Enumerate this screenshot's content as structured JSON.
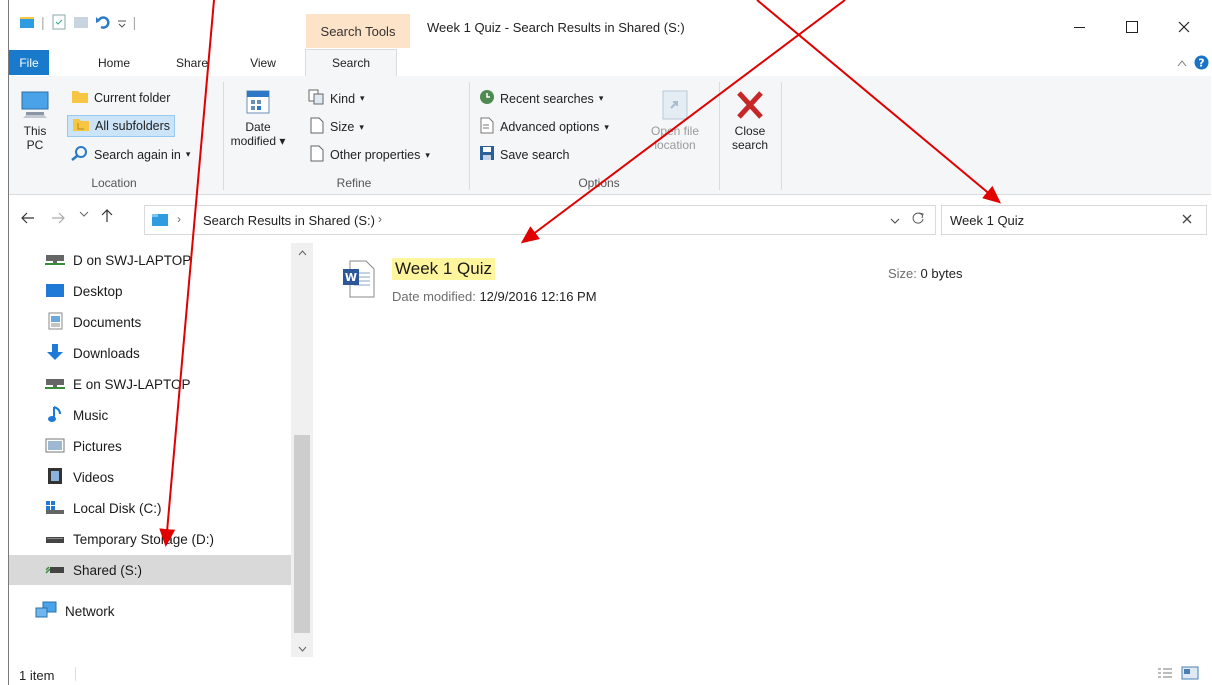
{
  "window": {
    "title": "Week 1 Quiz - Search Results in Shared (S:)",
    "context_tab": "Search Tools"
  },
  "tabs": [
    {
      "label": "File"
    },
    {
      "label": "Home"
    },
    {
      "label": "Share"
    },
    {
      "label": "View"
    },
    {
      "label": "Search"
    }
  ],
  "ribbon": {
    "location": {
      "label": "Location",
      "this_pc": "This PC",
      "current_folder": "Current folder",
      "all_subfolders": "All subfolders",
      "search_again_in": "Search again in"
    },
    "refine": {
      "label": "Refine",
      "date_modified": "Date modified",
      "kind": "Kind",
      "size": "Size",
      "other_properties": "Other properties"
    },
    "options": {
      "label": "Options",
      "recent_searches": "Recent searches",
      "advanced_options": "Advanced options",
      "save_search": "Save search",
      "open_file_location": "Open file location"
    },
    "close": {
      "close_search": "Close search"
    }
  },
  "address": {
    "path": "Search Results in Shared (S:)",
    "search_value": "Week 1 Quiz"
  },
  "nav": {
    "items": [
      {
        "label": "D on SWJ-LAPTOP",
        "icon": "network-drive-icon"
      },
      {
        "label": "Desktop",
        "icon": "desktop-icon"
      },
      {
        "label": "Documents",
        "icon": "documents-icon"
      },
      {
        "label": "Downloads",
        "icon": "downloads-icon"
      },
      {
        "label": "E on SWJ-LAPTOP",
        "icon": "network-drive-icon"
      },
      {
        "label": "Music",
        "icon": "music-icon"
      },
      {
        "label": "Pictures",
        "icon": "pictures-icon"
      },
      {
        "label": "Videos",
        "icon": "videos-icon"
      },
      {
        "label": "Local Disk (C:)",
        "icon": "local-disk-icon"
      },
      {
        "label": "Temporary Storage (D:)",
        "icon": "drive-icon"
      },
      {
        "label": "Shared (S:)",
        "icon": "shared-drive-icon"
      },
      {
        "label": "Network",
        "icon": "network-icon"
      }
    ]
  },
  "result": {
    "name": "Week 1 Quiz",
    "date_label": "Date modified:",
    "date_value": "12/9/2016 12:16 PM",
    "size_label": "Size:",
    "size_value": "0 bytes",
    "icon": "word-document-icon"
  },
  "status": {
    "items": "1 item"
  },
  "colors": {
    "file_tab": "#1979ca",
    "context_tab": "#fde3c8",
    "highlight": "#fff59d",
    "annotation_arrow": "#e00000"
  }
}
